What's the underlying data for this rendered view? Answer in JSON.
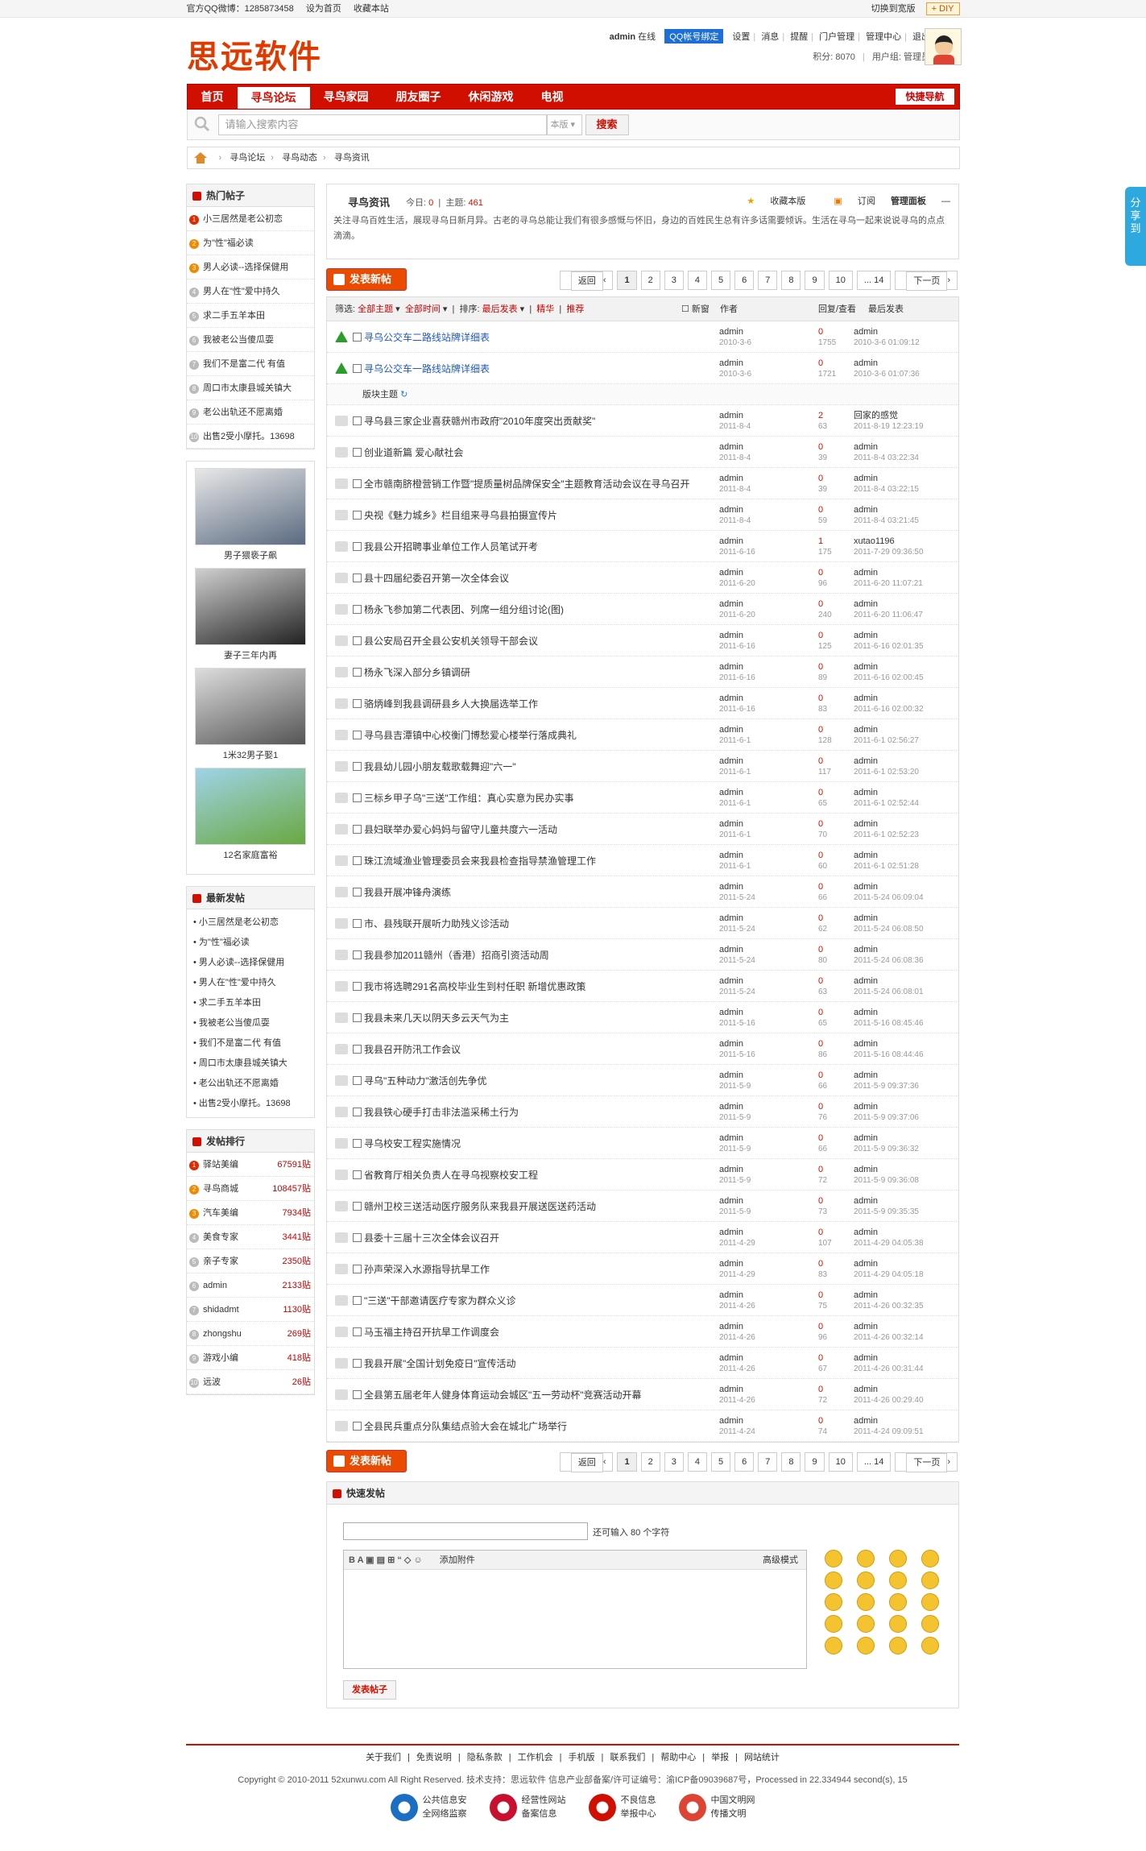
{
  "topbar": {
    "qq": "官方QQ微博：1285873458",
    "set_home": "设为首页",
    "favorite": "收藏本站",
    "switch_width": "切换到宽版",
    "diy": "+ DIY"
  },
  "header": {
    "logo": "思远软件",
    "user": "admin",
    "online": "在线",
    "qq_bind": "QQ帐号绑定",
    "links": [
      "设置",
      "消息",
      "提醒",
      "门户管理",
      "管理中心",
      "退出"
    ],
    "points": "积分: 8070",
    "group": "用户组: 管理员"
  },
  "nav": {
    "items": [
      "首页",
      "寻鸟论坛",
      "寻鸟家园",
      "朋友圈子",
      "休闲游戏",
      "电视"
    ],
    "quick": "快捷导航"
  },
  "search": {
    "placeholder": "请输入搜索内容",
    "scope": "本版",
    "button": "搜索"
  },
  "breadcrumb": [
    "寻鸟论坛",
    "寻鸟动态",
    "寻鸟资讯"
  ],
  "hot": {
    "title": "热门帖子",
    "items": [
      "小三居然是老公初恋",
      "为\"性\"福必读",
      "男人必读--选择保健用",
      "男人在\"性\"爱中持久",
      "求二手五羊本田",
      "我被老公当傻瓜耍",
      "我们不是富二代 有值",
      "周口市太康县城关镇大",
      "老公出轨还不愿离婚",
      "出售2受小摩托。13698"
    ]
  },
  "pics": [
    {
      "caption": "男子猥亵子飙"
    },
    {
      "caption": "妻子三年内再"
    },
    {
      "caption": "1米32男子娶1"
    },
    {
      "caption": "12名家庭富裕"
    }
  ],
  "newest": {
    "title": "最新发帖",
    "items": [
      "小三居然是老公初恋",
      "为\"性\"福必读",
      "男人必读--选择保健用",
      "男人在\"性\"爱中持久",
      "求二手五羊本田",
      "我被老公当傻瓜耍",
      "我们不是富二代 有值",
      "周口市太康县城关镇大",
      "老公出轨还不愿离婚",
      "出售2受小摩托。13698"
    ]
  },
  "rank": {
    "title": "发帖排行",
    "items": [
      {
        "name": "驿站美编",
        "value": "67591贴"
      },
      {
        "name": "寻鸟商城",
        "value": "108457贴"
      },
      {
        "name": "汽车美编",
        "value": "7934贴"
      },
      {
        "name": "美食专家",
        "value": "3441贴"
      },
      {
        "name": "亲子专家",
        "value": "2350贴"
      },
      {
        "name": "admin",
        "value": "2133贴"
      },
      {
        "name": "shidadmt",
        "value": "1130贴"
      },
      {
        "name": "zhongshu",
        "value": "269贴"
      },
      {
        "name": "游戏小编",
        "value": "418贴"
      },
      {
        "name": "远波",
        "value": "26贴"
      }
    ]
  },
  "forum": {
    "name": "寻鸟资讯",
    "today_label": "今日:",
    "today": "0",
    "threads_label": "主题:",
    "threads": "461",
    "ops": [
      "收藏本版",
      "订阅",
      "管理面板"
    ],
    "desc": "关注寻乌百姓生活，展现寻乌日新月异。古老的寻乌总能让我们有很多感慨与怀旧，身边的百姓民生总有许多话需要倾诉。生活在寻乌一起来说说寻乌的点点滴滴。"
  },
  "post_button": "发表新帖",
  "pager": {
    "prev": "返回",
    "pages": [
      "1",
      "2",
      "3",
      "4",
      "5",
      "6",
      "7",
      "8",
      "9",
      "10",
      "... 14"
    ],
    "next": "下一页"
  },
  "thead": {
    "filter": "筛选:",
    "all_threads": "全部主题",
    "all_time": "全部时间",
    "sort": "排序:",
    "latest": "最后发表",
    "digest": "精华",
    "recommend": "推荐",
    "new": "新窗",
    "author": "作者",
    "replies": "回复/查看",
    "last": "最后发表"
  },
  "section_label": "版块主题",
  "sticky": [
    {
      "title": "寻乌公交车二路线站牌详细表",
      "author": "admin",
      "date": "2010-3-6",
      "replies": "0",
      "views": "1755",
      "last_user": "admin",
      "last_date": "2010-3-6 01:09:12"
    },
    {
      "title": "寻乌公交车一路线站牌详细表",
      "author": "admin",
      "date": "2010-3-6",
      "replies": "0",
      "views": "1721",
      "last_user": "admin",
      "last_date": "2010-3-6 01:07:36"
    }
  ],
  "threads": [
    {
      "title": "寻乌县三家企业喜获赣州市政府\"2010年度突出贡献奖\"",
      "author": "admin",
      "date": "2011-8-4",
      "replies": "2",
      "views": "63",
      "last_user": "回家的感觉",
      "last_date": "2011-8-19 12:23:19"
    },
    {
      "title": "创业道新篇 爱心献社会",
      "author": "admin",
      "date": "2011-8-4",
      "replies": "0",
      "views": "39",
      "last_user": "admin",
      "last_date": "2011-8-4 03:22:34"
    },
    {
      "title": "全市赣南脐橙营销工作暨\"提质量树品牌保安全\"主题教育活动会议在寻乌召开",
      "author": "admin",
      "date": "2011-8-4",
      "replies": "0",
      "views": "39",
      "last_user": "admin",
      "last_date": "2011-8-4 03:22:15"
    },
    {
      "title": "央视《魅力城乡》栏目组来寻乌县拍摄宣传片",
      "author": "admin",
      "date": "2011-8-4",
      "replies": "0",
      "views": "59",
      "last_user": "admin",
      "last_date": "2011-8-4 03:21:45"
    },
    {
      "title": "我县公开招聘事业单位工作人员笔试开考",
      "author": "admin",
      "date": "2011-6-16",
      "replies": "1",
      "views": "175",
      "last_user": "xutao1196",
      "last_date": "2011-7-29 09:36:50"
    },
    {
      "title": "县十四届纪委召开第一次全体会议",
      "author": "admin",
      "date": "2011-6-20",
      "replies": "0",
      "views": "96",
      "last_user": "admin",
      "last_date": "2011-6-20 11:07:21"
    },
    {
      "title": "杨永飞参加第二代表团、列席一组分组讨论(图)",
      "author": "admin",
      "date": "2011-6-20",
      "replies": "0",
      "views": "240",
      "last_user": "admin",
      "last_date": "2011-6-20 11:06:47"
    },
    {
      "title": "县公安局召开全县公安机关领导干部会议",
      "author": "admin",
      "date": "2011-6-16",
      "replies": "0",
      "views": "125",
      "last_user": "admin",
      "last_date": "2011-6-16 02:01:35"
    },
    {
      "title": "杨永飞深入部分乡镇调研",
      "author": "admin",
      "date": "2011-6-16",
      "replies": "0",
      "views": "89",
      "last_user": "admin",
      "last_date": "2011-6-16 02:00:45"
    },
    {
      "title": "骆炳峰到我县调研县乡人大换届选举工作",
      "author": "admin",
      "date": "2011-6-16",
      "replies": "0",
      "views": "83",
      "last_user": "admin",
      "last_date": "2011-6-16 02:00:32"
    },
    {
      "title": "寻乌县吉潭镇中心校衡门博愁爱心楼举行落成典礼",
      "author": "admin",
      "date": "2011-6-1",
      "replies": "0",
      "views": "128",
      "last_user": "admin",
      "last_date": "2011-6-1 02:56:27"
    },
    {
      "title": "我县幼儿园小朋友载歌载舞迎\"六一\"",
      "author": "admin",
      "date": "2011-6-1",
      "replies": "0",
      "views": "117",
      "last_user": "admin",
      "last_date": "2011-6-1 02:53:20"
    },
    {
      "title": "三标乡甲子乌\"三送\"工作组：真心实意为民办实事",
      "author": "admin",
      "date": "2011-6-1",
      "replies": "0",
      "views": "65",
      "last_user": "admin",
      "last_date": "2011-6-1 02:52:44"
    },
    {
      "title": "县妇联举办爱心妈妈与留守儿童共度六一活动",
      "author": "admin",
      "date": "2011-6-1",
      "replies": "0",
      "views": "70",
      "last_user": "admin",
      "last_date": "2011-6-1 02:52:23"
    },
    {
      "title": "珠江流域渔业管理委员会来我县检查指导禁渔管理工作",
      "author": "admin",
      "date": "2011-6-1",
      "replies": "0",
      "views": "60",
      "last_user": "admin",
      "last_date": "2011-6-1 02:51:28"
    },
    {
      "title": "我县开展冲锋舟演练",
      "author": "admin",
      "date": "2011-5-24",
      "replies": "0",
      "views": "66",
      "last_user": "admin",
      "last_date": "2011-5-24 06:09:04"
    },
    {
      "title": "市、县残联开展听力助残义诊活动",
      "author": "admin",
      "date": "2011-5-24",
      "replies": "0",
      "views": "62",
      "last_user": "admin",
      "last_date": "2011-5-24 06:08:50"
    },
    {
      "title": "我县参加2011赣州（香港）招商引资活动周",
      "author": "admin",
      "date": "2011-5-24",
      "replies": "0",
      "views": "80",
      "last_user": "admin",
      "last_date": "2011-5-24 06:08:36"
    },
    {
      "title": "我市将选聘291名高校毕业生到村任职 新增优惠政策",
      "author": "admin",
      "date": "2011-5-24",
      "replies": "0",
      "views": "63",
      "last_user": "admin",
      "last_date": "2011-5-24 06:08:01"
    },
    {
      "title": "我县未来几天以阴天多云天气为主",
      "author": "admin",
      "date": "2011-5-16",
      "replies": "0",
      "views": "65",
      "last_user": "admin",
      "last_date": "2011-5-16 08:45:46"
    },
    {
      "title": "我县召开防汛工作会议",
      "author": "admin",
      "date": "2011-5-16",
      "replies": "0",
      "views": "86",
      "last_user": "admin",
      "last_date": "2011-5-16 08:44:46"
    },
    {
      "title": "寻乌\"五种动力\"激活创先争优",
      "author": "admin",
      "date": "2011-5-9",
      "replies": "0",
      "views": "66",
      "last_user": "admin",
      "last_date": "2011-5-9 09:37:36"
    },
    {
      "title": "我县铁心硬手打击非法滥采稀土行为",
      "author": "admin",
      "date": "2011-5-9",
      "replies": "0",
      "views": "76",
      "last_user": "admin",
      "last_date": "2011-5-9 09:37:06"
    },
    {
      "title": "寻乌校安工程实施情况",
      "author": "admin",
      "date": "2011-5-9",
      "replies": "0",
      "views": "66",
      "last_user": "admin",
      "last_date": "2011-5-9 09:36:32"
    },
    {
      "title": "省教育厅相关负责人在寻乌视察校安工程",
      "author": "admin",
      "date": "2011-5-9",
      "replies": "0",
      "views": "72",
      "last_user": "admin",
      "last_date": "2011-5-9 09:36:08"
    },
    {
      "title": "赣州卫校三送活动医疗服务队来我县开展送医送药活动",
      "author": "admin",
      "date": "2011-5-9",
      "replies": "0",
      "views": "73",
      "last_user": "admin",
      "last_date": "2011-5-9 09:35:35"
    },
    {
      "title": "县委十三届十三次全体会议召开",
      "author": "admin",
      "date": "2011-4-29",
      "replies": "0",
      "views": "107",
      "last_user": "admin",
      "last_date": "2011-4-29 04:05:38"
    },
    {
      "title": "孙声荣深入水源指导抗旱工作",
      "author": "admin",
      "date": "2011-4-29",
      "replies": "0",
      "views": "83",
      "last_user": "admin",
      "last_date": "2011-4-29 04:05:18"
    },
    {
      "title": "\"三送\"干部邀请医疗专家为群众义诊",
      "author": "admin",
      "date": "2011-4-26",
      "replies": "0",
      "views": "75",
      "last_user": "admin",
      "last_date": "2011-4-26 00:32:35"
    },
    {
      "title": "马玉福主持召开抗旱工作调度会",
      "author": "admin",
      "date": "2011-4-26",
      "replies": "0",
      "views": "96",
      "last_user": "admin",
      "last_date": "2011-4-26 00:32:14"
    },
    {
      "title": "我县开展\"全国计划免疫日\"宣传活动",
      "author": "admin",
      "date": "2011-4-26",
      "replies": "0",
      "views": "67",
      "last_user": "admin",
      "last_date": "2011-4-26 00:31:44"
    },
    {
      "title": "全县第五届老年人健身体育运动会城区\"五一劳动杯\"竞赛活动开幕",
      "author": "admin",
      "date": "2011-4-26",
      "replies": "0",
      "views": "72",
      "last_user": "admin",
      "last_date": "2011-4-26 00:29:40"
    },
    {
      "title": "全县民兵重点分队集结点验大会在城北广场举行",
      "author": "admin",
      "date": "2011-4-24",
      "replies": "0",
      "views": "74",
      "last_user": "admin",
      "last_date": "2011-4-24 09:09:51"
    }
  ],
  "quick_post": {
    "title": "快速发帖",
    "note": "还可输入 80 个字符",
    "toolbar": "B  A  ▣  ▤  ⊞  “  ◇  ☺",
    "attach": "添加附件",
    "advanced": "高级模式",
    "submit": "发表帖子"
  },
  "footer": {
    "links": [
      "关于我们",
      "免责说明",
      "隐私条款",
      "工作机会",
      "手机版",
      "联系我们",
      "帮助中心",
      "举报",
      "网站统计"
    ],
    "copyright": "Copyright © 2010-2011 52xunwu.com All Right Reserved.  技术支持：思远软件  信息产业部备案/许可证编号：渝ICP备09039687号，Processed in 22.334944 second(s), 15",
    "badges": [
      {
        "l1": "公共信息安",
        "l2": "全网络监察"
      },
      {
        "l1": "经营性网站",
        "l2": "备案信息"
      },
      {
        "l1": "不良信息",
        "l2": "举报中心"
      },
      {
        "l1": "中国文明网",
        "l2": "传播文明"
      }
    ]
  },
  "share": "分享到"
}
